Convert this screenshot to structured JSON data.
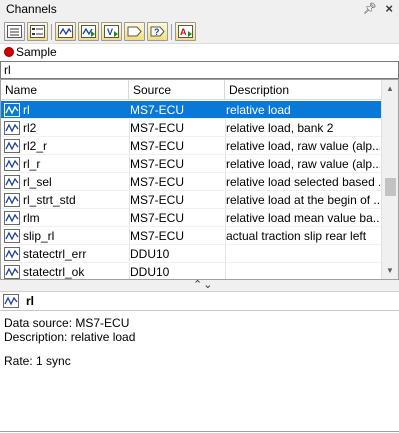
{
  "window": {
    "title": "Channels",
    "pin_icon": "pin-icon",
    "close_icon": "close-icon"
  },
  "toolbar": {
    "buttons": [
      {
        "name": "view-list-button",
        "icon": "list-view-icon"
      },
      {
        "name": "view-details-button",
        "icon": "details-view-icon"
      },
      {
        "name": "signal-button",
        "icon": "signal-icon"
      },
      {
        "name": "add-signal-button",
        "icon": "signal-add-icon"
      },
      {
        "name": "value-button",
        "icon": "value-icon"
      },
      {
        "name": "tag-button",
        "icon": "tag-icon"
      },
      {
        "name": "help-button",
        "icon": "help-icon"
      },
      {
        "name": "text-button",
        "icon": "text-icon"
      }
    ]
  },
  "source": {
    "label": "Sample",
    "status_color": "#d40000"
  },
  "search": {
    "value": "rl"
  },
  "columns": {
    "name": "Name",
    "source": "Source",
    "description": "Description"
  },
  "rows": [
    {
      "name": "rl",
      "source": "MS7-ECU",
      "description": "relative load",
      "selected": true
    },
    {
      "name": "rl2",
      "source": "MS7-ECU",
      "description": "relative load, bank 2"
    },
    {
      "name": "rl2_r",
      "source": "MS7-ECU",
      "description": "relative load, raw value (alp..."
    },
    {
      "name": "rl_r",
      "source": "MS7-ECU",
      "description": "relative load, raw value (alp..."
    },
    {
      "name": "rl_sel",
      "source": "MS7-ECU",
      "description": "relative load selected based ..."
    },
    {
      "name": "rl_strt_std",
      "source": "MS7-ECU",
      "description": "relative load at the begin of ..."
    },
    {
      "name": "rlm",
      "source": "MS7-ECU",
      "description": "relative load mean value ba..."
    },
    {
      "name": "slip_rl",
      "source": "MS7-ECU",
      "description": "actual traction slip rear left"
    },
    {
      "name": "statectrl_err",
      "source": "DDU10",
      "description": ""
    },
    {
      "name": "statectrl_ok",
      "source": "DDU10",
      "description": ""
    }
  ],
  "splitter": {
    "arrows": "⌃⌄"
  },
  "detail": {
    "name": "rl",
    "data_source": "Data source: MS7-ECU",
    "description": "Description: relative load",
    "rate": "Rate: 1 sync"
  },
  "colors": {
    "selection": "#0a78d7",
    "toolbar_button": "#f2de7a"
  }
}
